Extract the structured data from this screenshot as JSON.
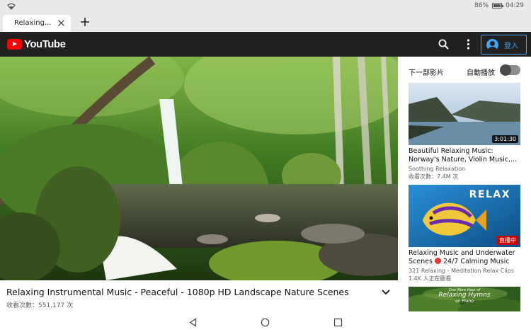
{
  "status_bar": {
    "battery": "86%",
    "battery_level": 0.86,
    "time": "04:29"
  },
  "browser": {
    "tab_title": "Relaxing..."
  },
  "header": {
    "logo_text": "YouTube",
    "signin_label": "登入"
  },
  "video": {
    "title": "Relaxing Instrumental Music - Peaceful - 1080p HD Landscape Nature Scenes",
    "views": "收看次數：551,177 次"
  },
  "sidebar": {
    "up_next": "下一部影片",
    "autoplay_label": "自動播放",
    "autoplay_on": false,
    "items": [
      {
        "title_line1": "Beautiful Relaxing Music:",
        "title_line2": "Norway's Nature, Violin Music,...",
        "channel": "Soothing Relaxation",
        "meta": "收看次數：7.4M 次",
        "duration": "3:01:30"
      },
      {
        "title_line1": "Relaxing Music and Underwater",
        "title_line2_prefix": "Scenes",
        "title_line2_suffix": "24/7 Calming Music",
        "channel": "321 Relaxing - Meditation Relax Clips",
        "meta": "1.4K 人正在觀看",
        "thumb_text": "RELAX",
        "badge": "直播中"
      },
      {
        "thumb_line1": "One More Hour of",
        "thumb_line2": "Relaxing Hymns",
        "thumb_line3": "on Piano"
      }
    ]
  },
  "colors": {
    "header_bg": "#212121",
    "accent_blue": "#3ea6ff",
    "youtube_red": "#ff0000",
    "live_red": "#cc0000"
  }
}
